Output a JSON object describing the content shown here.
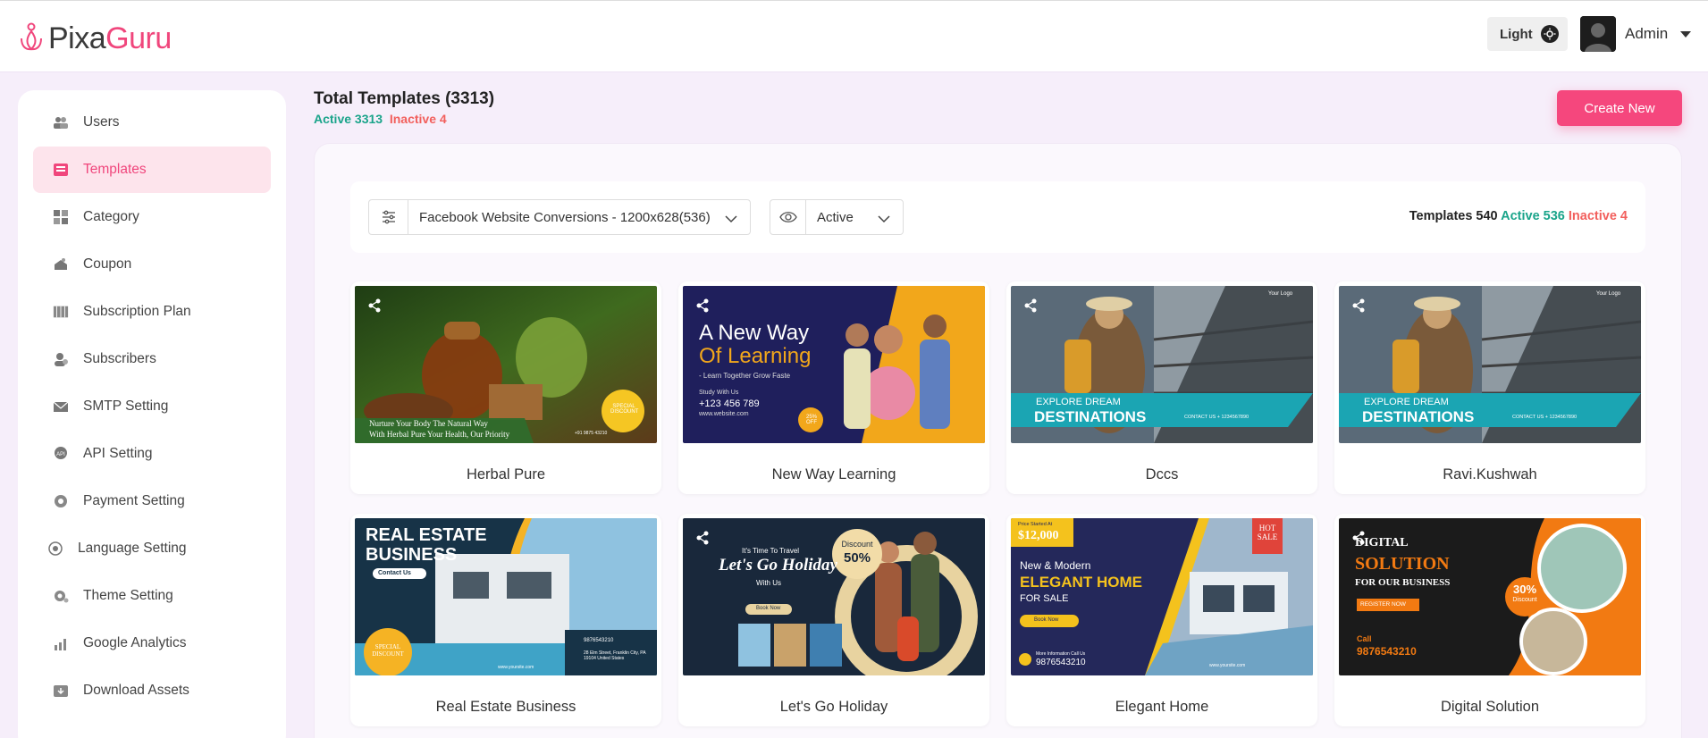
{
  "app": {
    "logo_part1": "Pixa",
    "logo_part2": "Guru"
  },
  "header": {
    "theme_label": "Light",
    "user_name": "Admin"
  },
  "sidebar": {
    "items": [
      {
        "label": "Users",
        "icon": "users-icon"
      },
      {
        "label": "Templates",
        "icon": "templates-icon",
        "active": true
      },
      {
        "label": "Category",
        "icon": "category-icon"
      },
      {
        "label": "Coupon",
        "icon": "coupon-icon"
      },
      {
        "label": "Subscription Plan",
        "icon": "subscription-icon"
      },
      {
        "label": "Subscribers",
        "icon": "subscribers-icon"
      },
      {
        "label": "SMTP Setting",
        "icon": "mail-icon"
      },
      {
        "label": "API Setting",
        "icon": "api-icon"
      },
      {
        "label": "Payment Setting",
        "icon": "payment-icon"
      },
      {
        "label": "Language Setting",
        "icon": "language-icon"
      },
      {
        "label": "Theme Setting",
        "icon": "theme-icon"
      },
      {
        "label": "Google Analytics",
        "icon": "analytics-icon"
      },
      {
        "label": "Download Assets",
        "icon": "download-icon"
      }
    ]
  },
  "page": {
    "title": "Total Templates (3313)",
    "active_label": "Active 3313",
    "inactive_label": "Inactive 4",
    "create_button": "Create New"
  },
  "filters": {
    "category_value": "Facebook Website Conversions - 1200x628(536)",
    "status_value": "Active",
    "summary_label": "Templates 540",
    "summary_active": "Active 536",
    "summary_inactive": "Inactive 4"
  },
  "templates": [
    {
      "name": "Herbal Pure",
      "text1": "Nurture Your Body The Natural Way",
      "text2": "With Herbal Pure Your Health, Our Priority",
      "badge": "SPECIAL DISCOUNT",
      "phone": "+91 9875 43210"
    },
    {
      "name": "New Way Learning",
      "text1": "A New Way",
      "text2": "Of Learning",
      "text3": "- Learn Together Grow Faste",
      "text4": "Study With Us",
      "text5": "+123 456 789",
      "text6": "www.website.com",
      "badge": "25% OFF"
    },
    {
      "name": "Dccs",
      "text1": "EXPLORE DREAM",
      "text2": "DESTINATIONS",
      "text3": "CONTACT US + 1234567890",
      "logo": "Your Logo"
    },
    {
      "name": "Ravi.Kushwah",
      "text1": "EXPLORE DREAM",
      "text2": "DESTINATIONS",
      "text3": "CONTACT US + 1234567890",
      "logo": "Your Logo"
    },
    {
      "name": "Real Estate Business",
      "text1": "REAL ESTATE",
      "text2": "BUSINESS",
      "text3": "Contact Us",
      "badge": "SPECIAL DISCOUNT",
      "phone": "9876543210",
      "addr": "28 Elm Street, Franklin City, PA 19104 United States",
      "web": "www.yoursite.com"
    },
    {
      "name": "Let's Go Holiday",
      "text1": "It's Time To Travel",
      "text2": "Let's Go Holiday",
      "text3": "With Us",
      "text4": "Book Now",
      "badge1": "Discount",
      "badge2": "50%"
    },
    {
      "name": "Elegant Home",
      "text0": "Price Started At",
      "price": "$12,000",
      "text1": "New & Modern",
      "text2": "ELEGANT HOME",
      "text3": "FOR SALE",
      "text4": "Book Now",
      "hot": "HOT SALE",
      "phone_label": "More Information Call Us",
      "phone": "9876543210",
      "web": "www.yoursite.com"
    },
    {
      "name": "Digital Solution",
      "text1": "DIGITAL",
      "text2": "SOLUTION",
      "text3": "FOR OUR BUSINESS",
      "text4": "REGISTER NOW",
      "call": "Call",
      "phone": "9876543210",
      "badge1": "30%",
      "badge2": "Discount"
    }
  ],
  "colors": {
    "accent": "#f5477d",
    "active": "#1aa48a",
    "inactive": "#f25f5c",
    "bg": "#f6eefa"
  }
}
